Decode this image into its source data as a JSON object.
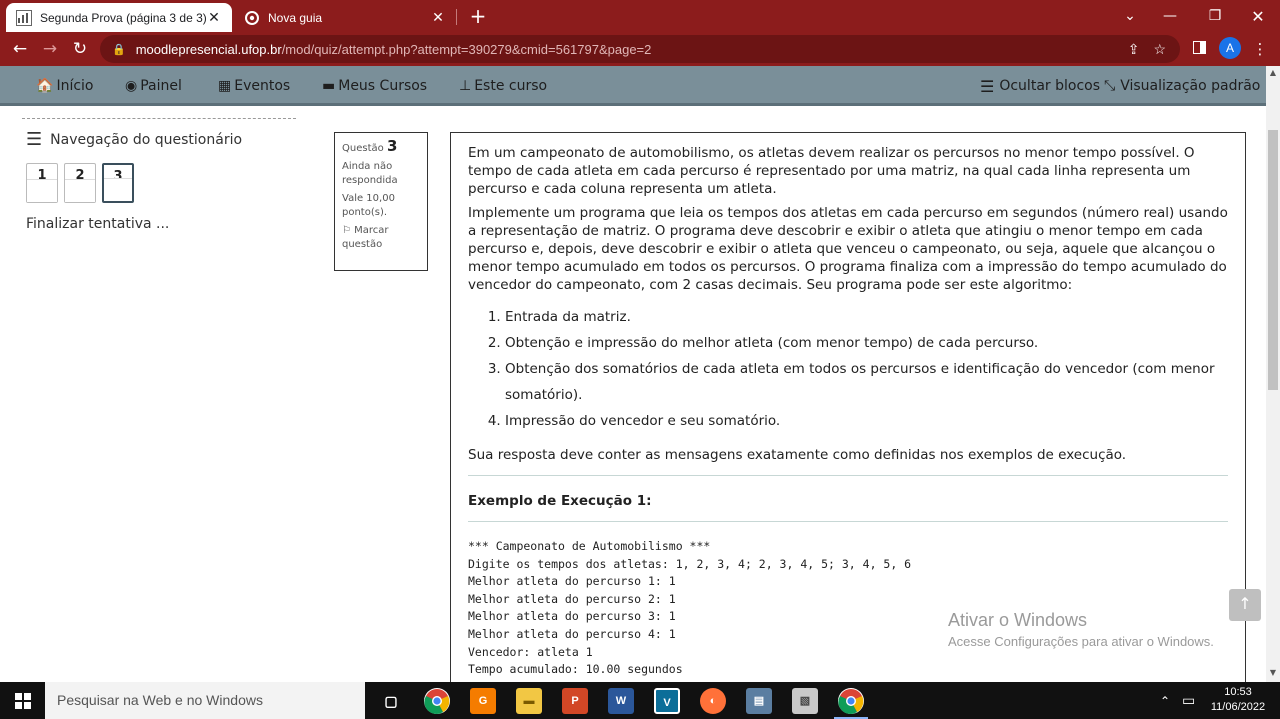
{
  "browser": {
    "tabs": [
      {
        "title": "Segunda Prova (página 3 de 3)",
        "active": true
      },
      {
        "title": "Nova guia",
        "active": false
      }
    ],
    "new_tab_icon": "+",
    "url_host": "moodlepresencial.ufop.br",
    "url_path": "/mod/quiz/attempt.php?attempt=390279&cmid=561797&page=2",
    "profile_initial": "A",
    "accent_color": "#8c1c1c"
  },
  "moodle_nav": {
    "items": [
      {
        "label": "Início",
        "icon": "home-icon"
      },
      {
        "label": "Painel",
        "icon": "dashboard-icon"
      },
      {
        "label": "Eventos",
        "icon": "calendar-icon"
      },
      {
        "label": "Meus Cursos",
        "icon": "briefcase-icon"
      },
      {
        "label": "Este curso",
        "icon": "sitemap-icon"
      }
    ],
    "hide_blocks": "Ocultar blocos",
    "default_view": "Visualização padrão"
  },
  "quiz_nav": {
    "title": "Navegação do questionário",
    "questions": [
      "1",
      "2",
      "3"
    ],
    "current": "3",
    "finish": "Finalizar tentativa ..."
  },
  "question_info": {
    "label": "Questão",
    "number": "3",
    "state": "Ainda não respondida",
    "grade": "Vale 10,00 ponto(s).",
    "flag": "Marcar questão"
  },
  "question": {
    "p1": "Em um campeonato de automobilismo, os atletas devem realizar os percursos no menor tempo possível. O tempo de cada atleta em cada percurso é representado por uma matriz, na qual cada linha representa um percurso e cada coluna representa um atleta.",
    "p2": "Implemente um programa que leia os tempos dos atletas em cada percurso em segundos (número real) usando a representação de matriz. O programa deve descobrir e exibir o atleta que atingiu o menor tempo em cada percurso e, depois, deve descobrir e exibir o atleta que venceu o campeonato, ou seja, aquele que alcançou o menor tempo acumulado em todos os percursos. O programa finaliza com a impressão do tempo acumulado do vencedor do campeonato, com 2 casas decimais. Seu programa pode ser este algoritmo:",
    "steps": [
      "Entrada da matriz.",
      "Obtenção e impressão do melhor atleta (com menor tempo) de cada percurso.",
      "Obtenção dos somatórios de cada atleta em todos os percursos e identificação do vencedor (com menor somatório).",
      "Impressão do vencedor e seu somatório."
    ],
    "note": "Sua resposta deve conter as mensagens exatamente como definidas nos exemplos de execução.",
    "example_title": "Exemplo de Execução 1:",
    "example_lines": [
      "*** Campeonato de Automobilismo ***",
      "Digite os tempos dos atletas: 1, 2, 3, 4; 2, 3, 4, 5; 3, 4, 5, 6",
      "Melhor atleta do percurso 1: 1",
      "Melhor atleta do percurso 2: 1",
      "Melhor atleta do percurso 3: 1",
      "Melhor atleta do percurso 4: 1",
      "Vencedor: atleta 1",
      "Tempo acumulado: 10.00 segundos"
    ]
  },
  "watermark": {
    "line1": "Ativar o Windows",
    "line2": "Acesse Configurações para ativar o Windows."
  },
  "taskbar": {
    "search_placeholder": "Pesquisar na Web e no Windows",
    "time": "10:53",
    "date": "11/06/2022"
  }
}
